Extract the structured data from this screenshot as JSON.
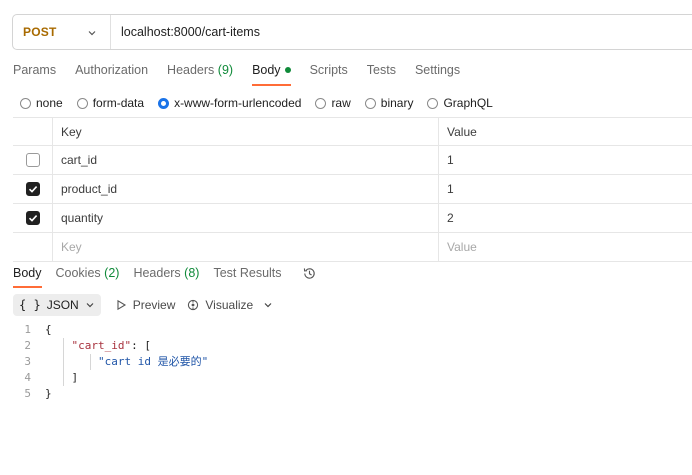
{
  "request": {
    "method": "POST",
    "url": "localhost:8000/cart-items"
  },
  "request_tabs": [
    {
      "label": "Params"
    },
    {
      "label": "Authorization"
    },
    {
      "label": "Headers",
      "count": "(9)"
    },
    {
      "label": "Body",
      "active": true
    },
    {
      "label": "Scripts"
    },
    {
      "label": "Tests"
    },
    {
      "label": "Settings"
    }
  ],
  "body_types": [
    {
      "label": "none"
    },
    {
      "label": "form-data"
    },
    {
      "label": "x-www-form-urlencoded",
      "selected": true
    },
    {
      "label": "raw"
    },
    {
      "label": "binary"
    },
    {
      "label": "GraphQL"
    }
  ],
  "params_table": {
    "header": {
      "key": "Key",
      "value": "Value"
    },
    "rows": [
      {
        "key": "cart_id",
        "value": "1",
        "checked": false
      },
      {
        "key": "product_id",
        "value": "1",
        "checked": true
      },
      {
        "key": "quantity",
        "value": "2",
        "checked": true
      }
    ],
    "placeholder": {
      "key": "Key",
      "value": "Value"
    }
  },
  "response_tabs": [
    {
      "label": "Body",
      "active": true
    },
    {
      "label": "Cookies",
      "count": "(2)"
    },
    {
      "label": "Headers",
      "count": "(8)"
    },
    {
      "label": "Test Results"
    }
  ],
  "response_toolbar": {
    "format_braces": "{ }",
    "format": "JSON",
    "preview": "Preview",
    "visualize": "Visualize"
  },
  "response_code": {
    "line_numbers": [
      "1",
      "2",
      "3",
      "4",
      "5"
    ],
    "open_brace": "{",
    "key": "\"cart_id\"",
    "colon": ": ",
    "open_bracket": "[",
    "message": "\"cart id 是必要的\"",
    "close_bracket": "]",
    "close_brace": "}"
  },
  "colors": {
    "method": "#a86a00",
    "accent": "#ff6c37",
    "count": "#0f8a39",
    "radio_selected": "#1a73e8",
    "json_key": "#a8323e",
    "json_string": "#2156a8"
  }
}
